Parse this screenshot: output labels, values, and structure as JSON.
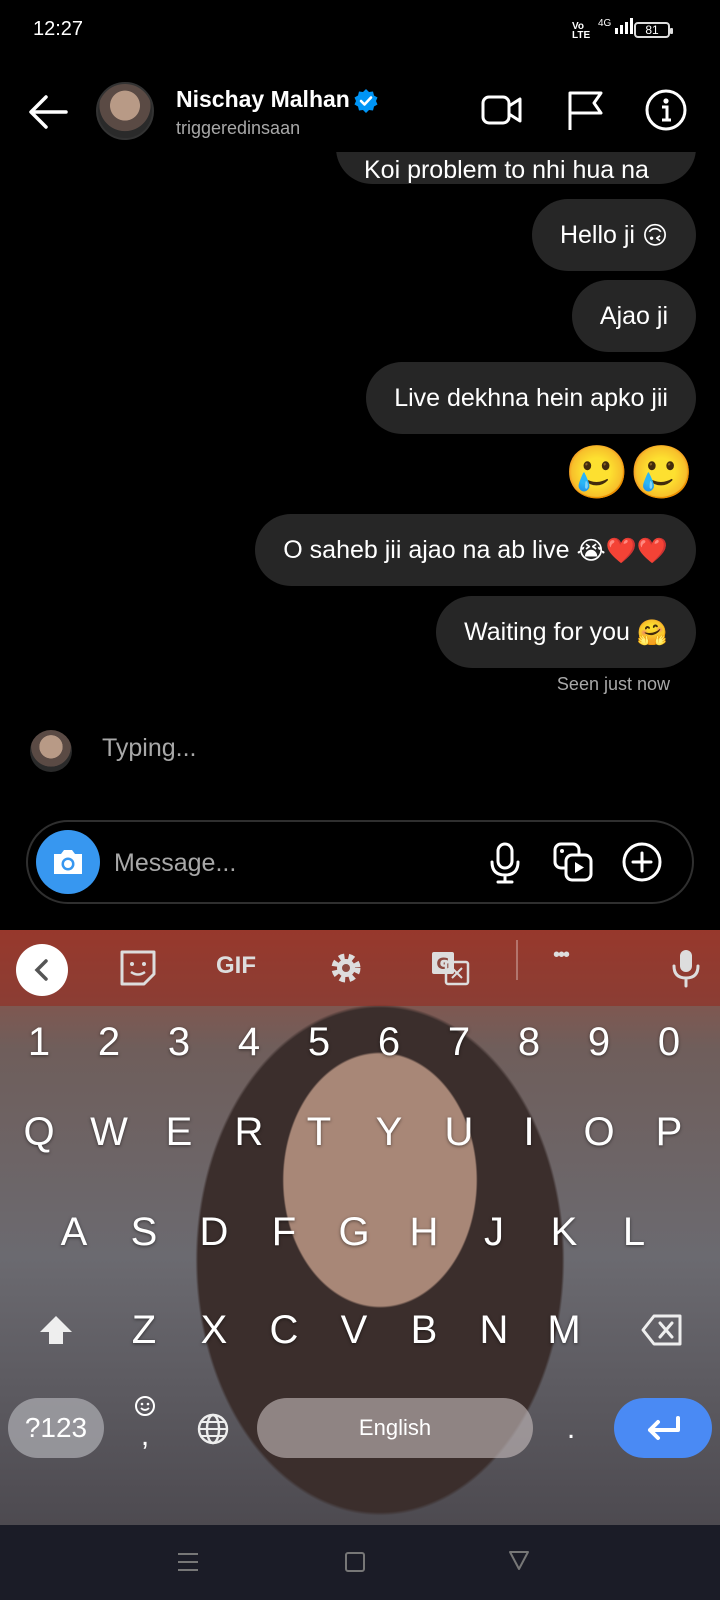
{
  "status_bar": {
    "time": "12:27",
    "network_top": "Vo",
    "network_bottom": "LTE",
    "signal": "4G",
    "battery": "81"
  },
  "header": {
    "name": "Nischay Malhan",
    "username": "triggeredinsaan"
  },
  "messages": {
    "partial": "Koi problem to nhi hua na",
    "m1": "Hello ji",
    "m1_emoji": "🙃",
    "m2": "Ajao ji",
    "m3": "Live dekhna hein apko jii",
    "m4_emoji": "🥲🥲",
    "m5": "O saheb jii ajao na ab live",
    "m5_emoji": "😭❤️❤️",
    "m6": "Waiting for you",
    "m6_emoji": "🤗",
    "seen": "Seen just now",
    "typing": "Typing..."
  },
  "composer": {
    "placeholder": "Message..."
  },
  "keyboard": {
    "toolbar_gif": "GIF",
    "toolbar_more": "•••",
    "numbers": [
      "1",
      "2",
      "3",
      "4",
      "5",
      "6",
      "7",
      "8",
      "9",
      "0"
    ],
    "row1": [
      "Q",
      "W",
      "E",
      "R",
      "T",
      "Y",
      "U",
      "I",
      "O",
      "P"
    ],
    "row2": [
      "A",
      "S",
      "D",
      "F",
      "G",
      "H",
      "J",
      "K",
      "L"
    ],
    "row3": [
      "Z",
      "X",
      "C",
      "V",
      "B",
      "N",
      "M"
    ],
    "symbols_key": "?123",
    "comma_key": ",",
    "space_label": "English",
    "period_key": ".",
    "accent_color": "#4a8af4"
  },
  "colors": {
    "bubble": "#262626",
    "camera_button": "#3797f0",
    "verified": "#0095f6"
  }
}
